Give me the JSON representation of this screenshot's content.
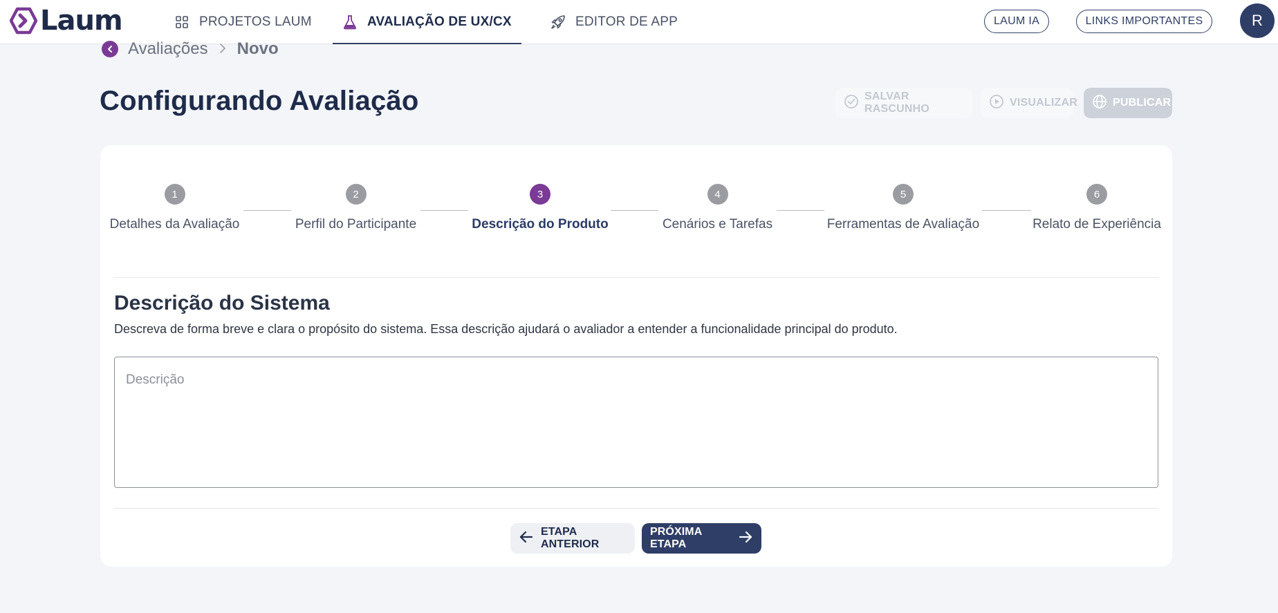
{
  "brand": {
    "logo_text": "Laum",
    "logo_color": "#7a3a96"
  },
  "nav": {
    "tabs": [
      {
        "label": "PROJETOS LAUM",
        "icon": "grid-icon"
      },
      {
        "label": "AVALIAÇÃO DE UX/CX",
        "icon": "flask-icon",
        "active": true
      },
      {
        "label": "EDITOR DE APP",
        "icon": "rocket-icon"
      }
    ],
    "ai_button": "LAUM IA",
    "links_button": "LINKS IMPORTANTES",
    "avatar_initial": "R"
  },
  "breadcrumb": {
    "parent": "Avaliações",
    "current": "Novo"
  },
  "header": {
    "title": "Configurando Avaliação",
    "save_draft": "SALVAR RASCUNHO",
    "preview": "VISUALIZAR",
    "publish": "PUBLICAR"
  },
  "stepper": {
    "steps": [
      {
        "number": "1",
        "label": "Detalhes da Avaliação"
      },
      {
        "number": "2",
        "label": "Perfil do Participante"
      },
      {
        "number": "3",
        "label": "Descrição do Produto",
        "active": true
      },
      {
        "number": "4",
        "label": "Cenários e Tarefas"
      },
      {
        "number": "5",
        "label": "Ferramentas de Avaliação"
      },
      {
        "number": "6",
        "label": "Relato de Experiência"
      }
    ]
  },
  "section": {
    "title": "Descrição do Sistema",
    "description": "Descreva de forma breve e clara o propósito do sistema. Essa descrição ajudará o avaliador a entender a funcionalidade principal do produto.",
    "textarea_placeholder": "Descrição",
    "textarea_value": ""
  },
  "footer": {
    "prev_label": "ETAPA ANTERIOR",
    "next_label": "PRÓXIMA ETAPA"
  },
  "colors": {
    "primary": "#2f3e66",
    "accent": "#7a3a96",
    "background": "#f3f5f8"
  }
}
